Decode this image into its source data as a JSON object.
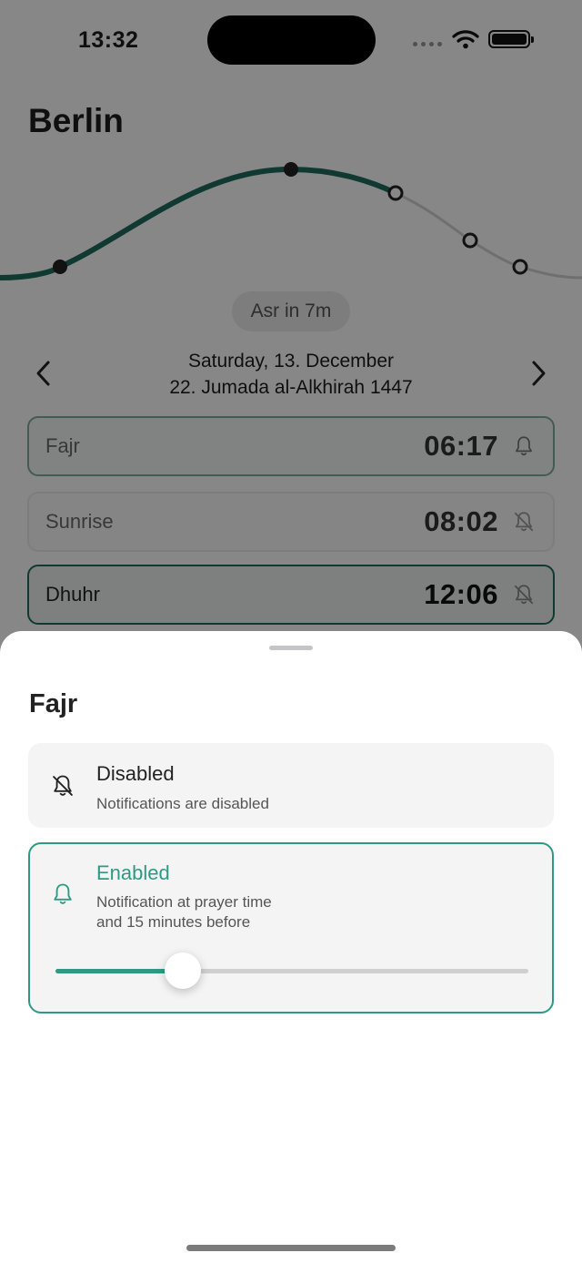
{
  "status_bar": {
    "time": "13:32"
  },
  "city": "Berlin",
  "next_prayer_pill": "Asr in 7m",
  "date": {
    "gregorian": "Saturday, 13. December",
    "hijri": "22. Jumada al-Alkhirah 1447"
  },
  "prayers": [
    {
      "name": "Fajr",
      "time": "06:17",
      "notification": "on"
    },
    {
      "name": "Sunrise",
      "time": "08:02",
      "notification": "off"
    },
    {
      "name": "Dhuhr",
      "time": "12:06",
      "notification": "off"
    }
  ],
  "sheet": {
    "title": "Fajr",
    "options": {
      "disabled": {
        "title": "Disabled",
        "subtitle": "Notifications are disabled"
      },
      "enabled": {
        "title": "Enabled",
        "subtitle_line1": "Notification at prayer time",
        "subtitle_line2": "and 15 minutes before"
      }
    },
    "slider_fraction": 0.27
  },
  "colors": {
    "accent": "#2f9a84",
    "curve_dark": "#1f6e5d"
  },
  "icons": [
    "back-chevron-icon",
    "forward-chevron-icon",
    "bell-icon",
    "bell-slash-icon",
    "wifi-icon",
    "battery-icon"
  ]
}
